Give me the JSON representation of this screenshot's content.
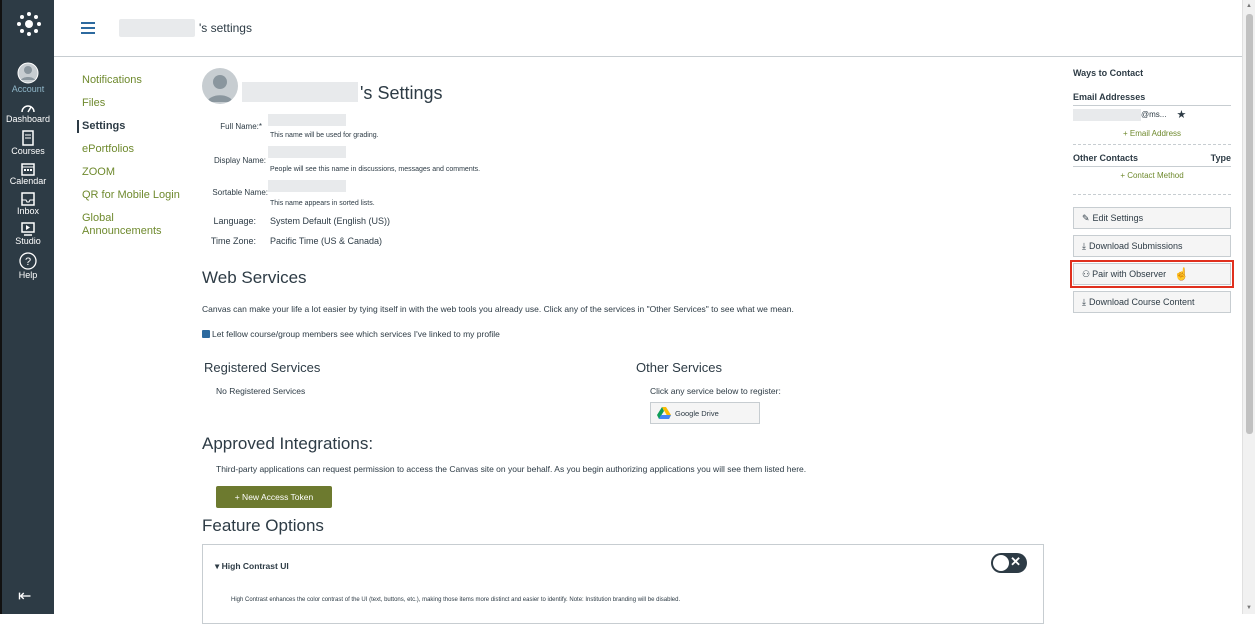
{
  "header": {
    "crumb_suffix": "'s settings"
  },
  "global_nav": {
    "items": [
      {
        "label": "Account",
        "icon": "account-icon"
      },
      {
        "label": "Dashboard",
        "icon": "dashboard-icon"
      },
      {
        "label": "Courses",
        "icon": "courses-icon"
      },
      {
        "label": "Calendar",
        "icon": "calendar-icon"
      },
      {
        "label": "Inbox",
        "icon": "inbox-icon"
      },
      {
        "label": "Studio",
        "icon": "studio-icon"
      },
      {
        "label": "Help",
        "icon": "help-icon"
      }
    ]
  },
  "left_nav": {
    "items": [
      {
        "label": "Notifications"
      },
      {
        "label": "Files"
      },
      {
        "label": "Settings"
      },
      {
        "label": "ePortfolios"
      },
      {
        "label": "ZOOM"
      },
      {
        "label": "QR for Mobile Login"
      },
      {
        "label": "Global Announcements"
      }
    ]
  },
  "main": {
    "title_suffix": "'s Settings",
    "full_name_label": "Full Name:*",
    "full_name_help": "This name will be used for grading.",
    "display_name_label": "Display Name:",
    "display_name_help": "People will see this name in discussions, messages and comments.",
    "sortable_name_label": "Sortable Name:",
    "sortable_name_help": "This name appears in sorted lists.",
    "language_label": "Language:",
    "language_value": "System Default (English (US))",
    "timezone_label": "Time Zone:",
    "timezone_value": "Pacific Time (US & Canada)",
    "web_services_heading": "Web Services",
    "web_services_desc": "Canvas can make your life a lot easier by tying itself in with the web tools you already use. Click any of the services in \"Other Services\" to see what we mean.",
    "share_services_label": "Let fellow course/group members see which services I've linked to my profile",
    "registered_heading": "Registered Services",
    "registered_empty": "No Registered Services",
    "other_heading": "Other Services",
    "other_hint": "Click any service below to register:",
    "google_drive_label": "Google Drive",
    "approved_heading": "Approved Integrations:",
    "approved_desc": "Third-party applications can request permission to access the Canvas site on your behalf. As you begin authorizing applications you will see them listed here.",
    "new_token_label": "+ New Access Token",
    "feature_heading": "Feature Options",
    "feature_title": "High Contrast UI",
    "feature_desc": "High Contrast enhances the color contrast of the UI (text, buttons, etc.), making those items more distinct and easier to identify. Note: Institution branding will be disabled."
  },
  "right_sidebar": {
    "ways_heading": "Ways to Contact",
    "email_heading": "Email Addresses",
    "email_suffix": "@ms...",
    "add_email_label": "+ Email Address",
    "other_contacts_heading": "Other Contacts",
    "type_heading": "Type",
    "add_contact_label": "+ Contact Method",
    "buttons": [
      {
        "label": "Edit Settings"
      },
      {
        "label": "Download Submissions"
      },
      {
        "label": "Pair with Observer"
      },
      {
        "label": "Download Course Content"
      }
    ]
  },
  "colors": {
    "nav_bg": "#2d3b45",
    "link": "#6f8a2e",
    "highlight": "#e0301e",
    "primary_button": "#6d7a2f"
  }
}
